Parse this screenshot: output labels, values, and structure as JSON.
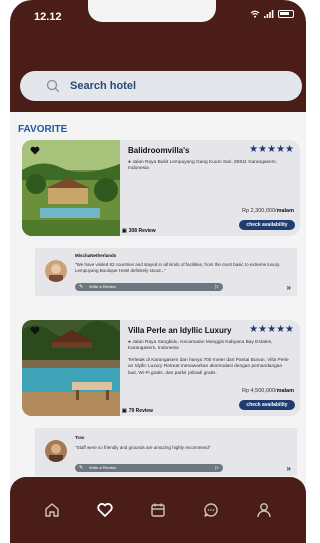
{
  "status_bar": {
    "time": "12.12"
  },
  "search": {
    "placeholder": "Search hotel"
  },
  "section": {
    "title": "FAVORITE"
  },
  "hotels": [
    {
      "name": "Balidroomvilla's",
      "stars": "★★★★★",
      "address": "Jalan Raya Bukit Lempuyang Gang Kuum Sari, 80611 Karangasem, Indonesia",
      "description": "",
      "price": "Rp 2,300,000/",
      "price_unit": "malam",
      "check_label": "check availability",
      "review_count": "308 Review",
      "review": {
        "author": "MischaNetherlands",
        "text": "\"We have visited 82 countries and stayed in all kinds of facilities, from the most basic to extreme luxury. Lempuyang Boutique Hotel definitely stood...\"",
        "write_label": "Write a Review"
      }
    },
    {
      "name": "Villa Perle an Idyllic Luxury",
      "stars": "★★★★★",
      "address": "Jalan Raya Sangkidu, Kecamatan Manggis Kabyana Bay Estates, Karangasem, Indonesia",
      "description": "Terletak di Karangasem dan hanya 700 meter dari Pantai Bunan, Villa Perle an Idyllic Luxury Retreat menawarkan akomodasi dengan pemandangan laut, Wi-Fi gratis, dan parkir pribadi gratis.",
      "price": "Rp 4,500,000/",
      "price_unit": "malam",
      "check_label": "check availability",
      "review_count": "79 Review",
      "review": {
        "author": "Trav",
        "text": "\"Staff were so friendly and grounds are amazing highly recommend\"",
        "write_label": "Write a Review"
      }
    }
  ],
  "colors": {
    "primary": "#4a1d18",
    "accent": "#1f3c6e",
    "title": "#1f5aa5"
  }
}
